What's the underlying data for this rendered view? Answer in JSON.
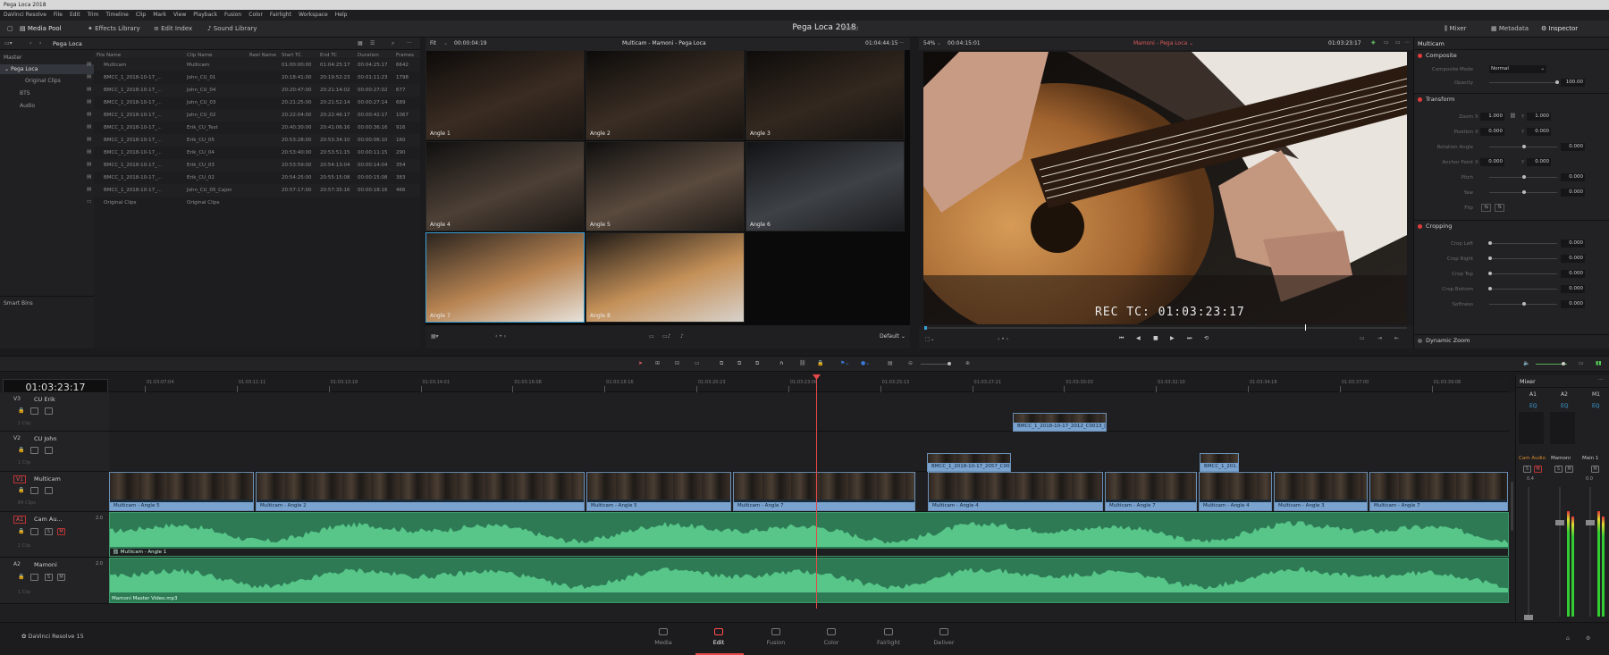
{
  "window": {
    "title": "Pega Loca 2018"
  },
  "menu": [
    "DaVinci Resolve",
    "File",
    "Edit",
    "Trim",
    "Timeline",
    "Clip",
    "Mark",
    "View",
    "Playback",
    "Fusion",
    "Color",
    "Fairlight",
    "Workspace",
    "Help"
  ],
  "toolbar": {
    "media_pool": "Media Pool",
    "effects_library": "Effects Library",
    "edit_index": "Edit Index",
    "sound_library": "Sound Library",
    "project_name": "Pega Loca 2018",
    "edited": "Edited",
    "mixer": "Mixer",
    "metadata": "Metadata",
    "inspector": "Inspector"
  },
  "media_pool": {
    "breadcrumb": "Pega Loca",
    "bins": {
      "master": "Master",
      "project": "Pega Loca",
      "children": [
        "Original Clips",
        "BTS",
        "Audio"
      ],
      "smart_bins": "Smart Bins"
    },
    "columns": [
      "File Name",
      "Clip Name",
      "Reel Name",
      "Start TC",
      "End TC",
      "Duration",
      "Frames"
    ],
    "rows": [
      [
        "Multicam",
        "Multicam",
        "",
        "01:00:00:00",
        "01:04:25:17",
        "00:04:25:17",
        "6642"
      ],
      [
        "BMCC_1_2018-10-17_...",
        "John_CU_01",
        "",
        "20:18:41:00",
        "20:19:52:23",
        "00:01:11:23",
        "1798"
      ],
      [
        "BMCC_1_2018-10-17_...",
        "John_CU_04",
        "",
        "20:20:47:00",
        "20:21:14:02",
        "00:00:27:02",
        "677"
      ],
      [
        "BMCC_1_2018-10-17_...",
        "John_CU_03",
        "",
        "20:21:25:00",
        "20:21:52:14",
        "00:00:27:14",
        "689"
      ],
      [
        "BMCC_1_2018-10-17_...",
        "John_CU_02",
        "",
        "20:22:04:00",
        "20:22:46:17",
        "00:00:42:17",
        "1067"
      ],
      [
        "BMCC_1_2018-10-17_...",
        "Erik_CU_Test",
        "",
        "20:40:30:00",
        "20:41:06:16",
        "00:00:36:16",
        "916"
      ],
      [
        "BMCC_1_2018-10-17_...",
        "Erik_CU_05",
        "",
        "20:53:28:00",
        "20:53:34:10",
        "00:00:06:10",
        "160"
      ],
      [
        "BMCC_1_2018-10-17_...",
        "Erik_CU_04",
        "",
        "20:53:40:00",
        "20:53:51:15",
        "00:00:11:15",
        "290"
      ],
      [
        "BMCC_1_2018-10-17_...",
        "Erik_CU_03",
        "",
        "20:53:59:00",
        "20:54:13:04",
        "00:00:14:04",
        "354"
      ],
      [
        "BMCC_1_2018-10-17_...",
        "Erik_CU_02",
        "",
        "20:54:25:00",
        "20:55:15:08",
        "00:00:15:08",
        "383"
      ],
      [
        "BMCC_1_2018-10-17_...",
        "John_CU_05_Cajon",
        "",
        "20:57:17:00",
        "20:57:35:16",
        "00:00:18:16",
        "466"
      ],
      [
        "Original Clips",
        "Original Clips",
        "",
        "",
        "",
        "",
        ""
      ]
    ]
  },
  "multiview": {
    "zoom": "Fit",
    "timecode": "00:00:04:19",
    "title": "Multicam - Mamoni - Pega Loca",
    "end_tc": "01:04:44:15",
    "angles": [
      "Angle 1",
      "Angle 2",
      "Angle 3",
      "Angle 4",
      "Angle 5",
      "Angle 6",
      "Angle 7",
      "Angle 8"
    ],
    "default": "Default"
  },
  "viewer": {
    "zoom": "54%",
    "timecode": "00:04:15:01",
    "title": "Mamoni - Pega Loca",
    "tc": "01:03:23:17",
    "burnin": "REC TC: 01:03:23:17"
  },
  "inspector": {
    "title": "Multicam",
    "composite": {
      "label": "Composite",
      "mode_label": "Composite Mode",
      "mode": "Normal",
      "opacity_label": "Opacity",
      "opacity": "100.00"
    },
    "transform": {
      "label": "Transform",
      "zoom_label": "Zoom",
      "zoom_x": "1.000",
      "zoom_y": "1.000",
      "position_label": "Position",
      "pos_x": "0.000",
      "pos_y": "0.000",
      "rotation_label": "Rotation Angle",
      "rotation": "0.000",
      "anchor_label": "Anchor Point",
      "anchor_x": "0.000",
      "anchor_y": "0.000",
      "pitch_label": "Pitch",
      "pitch": "0.000",
      "yaw_label": "Yaw",
      "yaw": "0.000",
      "flip_label": "Flip"
    },
    "cropping": {
      "label": "Cropping",
      "left_label": "Crop Left",
      "left": "0.000",
      "right_label": "Crop Right",
      "right": "0.000",
      "top_label": "Crop Top",
      "top": "0.000",
      "bottom_label": "Crop Bottom",
      "bottom": "0.000",
      "softness_label": "Softness",
      "softness": "0.000"
    },
    "dynamic_zoom": "Dynamic Zoom",
    "axis_x": "X",
    "axis_y": "Y"
  },
  "timeline": {
    "timecode": "01:03:23:17",
    "ruler": [
      "01:03:07:04",
      "01:03:11:11",
      "01:03:13:18",
      "01:03:14:01",
      "01:03:16:08",
      "01:03:18:16",
      "01:03:20:23",
      "01:03:23:06",
      "01:03:25:13",
      "01:03:27:21",
      "01:03:30:03",
      "01:03:32:10",
      "01:03:34:18",
      "01:03:37:00",
      "01:03:39:08"
    ],
    "tracks": {
      "v3": {
        "id": "V3",
        "name": "CU Erik",
        "count": "1 Clip"
      },
      "v2": {
        "id": "V2",
        "name": "CU John",
        "count": "1 Clip"
      },
      "v1": {
        "id": "V1",
        "name": "Multicam",
        "count": "84 Clips"
      },
      "a1": {
        "id": "A1",
        "name": "Cam Au...",
        "level": "2.0",
        "count": "1 Clip"
      },
      "a2": {
        "id": "A2",
        "name": "Mamoni",
        "level": "2.0",
        "count": "1 Clip"
      }
    },
    "v3_clip": "BMCC_1_2018-10-17_2012_C0013_[0...",
    "v2_clips": [
      "BMCC_1_2018-10-17_2057_C001...",
      "BMCC_1_201..."
    ],
    "v1_clips": [
      "Multicam - Angle 5",
      "Multicam - Angle 2",
      "Multicam - Angle 5",
      "Multicam - Angle 7",
      "Multicam - Angle 4",
      "Multicam - Angle 7",
      "Multicam - Angle 4",
      "Multicam - Angle 3",
      "Multicam - Angle 7"
    ],
    "a1_clip": "Multicam - Angle 1",
    "a2_clip": "Mamoni Master Video.mp3",
    "colors": {
      "video": "#7aa3cf",
      "audio": "#2d7a55",
      "playhead": "#e64848"
    }
  },
  "mixer": {
    "title": "Mixer",
    "channels": [
      "A1",
      "A2",
      "M1"
    ],
    "eq": "EQ",
    "names": [
      "Cam Audio",
      "Mamoni",
      "Main 1"
    ],
    "levels": [
      "0.4",
      "0.0"
    ]
  },
  "app_name": "DaVinci Resolve 15",
  "pages": [
    "Media",
    "Edit",
    "Fusion",
    "Color",
    "Fairlight",
    "Deliver"
  ],
  "active_page": "Edit"
}
